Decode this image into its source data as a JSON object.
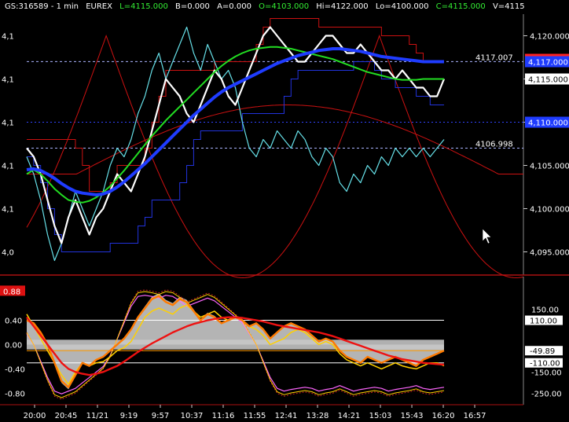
{
  "header": {
    "symbol": "GS:316589 - 1 min",
    "exchange": "EUREX",
    "last": "L=4115.000",
    "bid": "B=0.000",
    "ask": "A=0.000",
    "open": "O=4103.000",
    "high": "Hi=4122.000",
    "low": "Lo=4100.000",
    "close": "C=4115.000",
    "volume": "V=4115"
  },
  "colors": {
    "background": "#000000",
    "price": "#ffffff",
    "cyan_line": "#66e0e8",
    "blue_ma": "#1f3cff",
    "green_ma": "#22dd22",
    "red_bands": "#cc1111",
    "osc_gray": "#c8c8c8",
    "osc_orange": "#ff7a00",
    "osc_yellow": "#ffd000",
    "osc_red": "#ee1111",
    "osc_magenta": "#ff66ff"
  },
  "chart_data": [
    {
      "type": "line",
      "panel": "price",
      "ylim": [
        4092.5,
        4122.5
      ],
      "y_ticks": [
        4095,
        4100,
        4105,
        4110,
        4115,
        4120
      ],
      "y_tick_labels": [
        "4,095.000",
        "4,100.000",
        "4,105.000",
        "4,110.000",
        "4,115.000",
        "4,120.000"
      ],
      "left_tick_labels": [
        "4,0",
        "4,1",
        "4,1",
        "4,1",
        "4,1",
        "4,1"
      ],
      "annotations": [
        {
          "label": "4117.007",
          "value": 4117.007
        },
        {
          "label": "4106.998",
          "value": 4106.998
        }
      ],
      "tags": [
        {
          "label": "4,115.000",
          "value": 4115.0,
          "color": "#ffffff"
        },
        {
          "label": "4,110.000",
          "value": 4110.0,
          "color": "#1f3cff"
        },
        {
          "label": "4,117.000",
          "value": 4117.0,
          "color": "#1f3cff"
        }
      ],
      "x": [
        0,
        1,
        2,
        3,
        4,
        5,
        6,
        7,
        8,
        9,
        10,
        11,
        12,
        13,
        14,
        15,
        16,
        17,
        18,
        19,
        20,
        21,
        22,
        23,
        24,
        25,
        26,
        27,
        28,
        29,
        30,
        31,
        32,
        33,
        34,
        35,
        36,
        37,
        38,
        39,
        40,
        41,
        42,
        43,
        44,
        45,
        46,
        47,
        48,
        49,
        50,
        51,
        52,
        53,
        54,
        55,
        56,
        57,
        58,
        59,
        60
      ],
      "series": [
        {
          "values": [
            4107,
            4106,
            4104,
            4101,
            4098,
            4096,
            4099,
            4101,
            4099,
            4097,
            4099,
            4100,
            4102,
            4104,
            4103,
            4102,
            4104,
            4106,
            4109,
            4112,
            4115,
            4114,
            4113,
            4111,
            4110,
            4112,
            4114,
            4116,
            4115,
            4113,
            4112,
            4114,
            4116,
            4118,
            4120,
            4121,
            4120,
            4119,
            4118,
            4117,
            4117,
            4118,
            4119,
            4120,
            4120,
            4119,
            4118,
            4118,
            4119,
            4118,
            4117,
            4116,
            4116,
            4115,
            4116,
            4115,
            4114,
            4114,
            4113,
            4113,
            4115
          ]
        },
        {
          "values": [
            4106,
            4104,
            4101,
            4097,
            4094,
            4096,
            4099,
            4102,
            4100,
            4098,
            4100,
            4102,
            4105,
            4107,
            4106,
            4108,
            4111,
            4113,
            4116,
            4118,
            4115,
            4117,
            4119,
            4121,
            4118,
            4116,
            4119,
            4117,
            4115,
            4116,
            4114,
            4110,
            4107,
            4106,
            4108,
            4107,
            4109,
            4108,
            4107,
            4109,
            4108,
            4106,
            4105,
            4107,
            4106,
            4103,
            4102,
            4104,
            4103,
            4105,
            4104,
            4106,
            4105,
            4107,
            4106,
            4107,
            4106,
            4107,
            4106,
            4107,
            4108
          ]
        },
        {
          "values": [
            4104.5,
            4104.6,
            4104.4,
            4104.0,
            4103.5,
            4102.9,
            4102.4,
            4102.0,
            4101.8,
            4101.7,
            4101.6,
            4101.7,
            4102.0,
            4102.5,
            4103.1,
            4103.8,
            4104.5,
            4105.2,
            4106.0,
            4106.8,
            4107.6,
            4108.4,
            4109.2,
            4110.0,
            4110.8,
            4111.5,
            4112.2,
            4112.9,
            4113.5,
            4114.0,
            4114.4,
            4114.8,
            4115.2,
            4115.6,
            4116.0,
            4116.4,
            4116.8,
            4117.1,
            4117.4,
            4117.7,
            4117.9,
            4118.1,
            4118.3,
            4118.4,
            4118.5,
            4118.5,
            4118.4,
            4118.3,
            4118.2,
            4118.0,
            4117.8,
            4117.6,
            4117.5,
            4117.4,
            4117.3,
            4117.2,
            4117.1,
            4117.0,
            4117.0,
            4117.0,
            4117.0
          ]
        },
        {
          "values": [
            4104.0,
            4104.5,
            4104.0,
            4103.2,
            4102.3,
            4101.6,
            4101.0,
            4100.8,
            4100.7,
            4100.9,
            4101.3,
            4101.9,
            4102.6,
            4103.5,
            4104.4,
            4105.4,
            4106.4,
            4107.4,
            4108.4,
            4109.3,
            4110.2,
            4111.0,
            4111.8,
            4112.6,
            4113.4,
            4114.2,
            4115.0,
            4115.8,
            4116.5,
            4117.1,
            4117.6,
            4118.0,
            4118.3,
            4118.5,
            4118.6,
            4118.7,
            4118.7,
            4118.6,
            4118.5,
            4118.3,
            4118.1,
            4117.9,
            4117.7,
            4117.5,
            4117.3,
            4117.0,
            4116.7,
            4116.4,
            4116.1,
            4115.8,
            4115.6,
            4115.4,
            4115.2,
            4115.0,
            4114.9,
            4114.9,
            4114.9,
            4115.0,
            4115.0,
            4115.0,
            4115.0
          ]
        }
      ]
    },
    {
      "type": "line",
      "panel": "oscillator",
      "ylim": [
        -0.95,
        0.95
      ],
      "y_ticks": [
        0.4,
        0.0,
        -0.4,
        -0.8
      ],
      "y_tick_labels": [
        "0.40",
        "0.00",
        "-0.40",
        "-0.80"
      ],
      "left_highlight_label": "0.88",
      "right_tick_labels": [
        "150.00",
        "-150.00",
        "-250.00"
      ],
      "right_tags": [
        {
          "label": "110.00",
          "color": "#ffffff"
        },
        {
          "label": "-49.89",
          "color": "#ffffff"
        },
        {
          "label": "-110.00",
          "color": "#ffffff"
        }
      ],
      "x": [
        0,
        1,
        2,
        3,
        4,
        5,
        6,
        7,
        8,
        9,
        10,
        11,
        12,
        13,
        14,
        15,
        16,
        17,
        18,
        19,
        20,
        21,
        22,
        23,
        24,
        25,
        26,
        27,
        28,
        29,
        30,
        31,
        32,
        33,
        34,
        35,
        36,
        37,
        38,
        39,
        40,
        41,
        42,
        43,
        44,
        45,
        46,
        47,
        48,
        49,
        50,
        51,
        52,
        53,
        54,
        55,
        56,
        57,
        58,
        59,
        60
      ],
      "series": [
        {
          "values": [
            0.4,
            0.35,
            0.2,
            0.0,
            -0.3,
            -0.6,
            -0.7,
            -0.5,
            -0.3,
            -0.35,
            -0.25,
            -0.2,
            -0.1,
            0.0,
            0.1,
            0.25,
            0.45,
            0.6,
            0.75,
            0.8,
            0.7,
            0.65,
            0.75,
            0.7,
            0.55,
            0.4,
            0.5,
            0.45,
            0.35,
            0.4,
            0.45,
            0.4,
            0.3,
            0.35,
            0.25,
            0.1,
            0.2,
            0.3,
            0.35,
            0.3,
            0.25,
            0.15,
            0.05,
            0.1,
            0.05,
            -0.1,
            -0.2,
            -0.25,
            -0.3,
            -0.2,
            -0.25,
            -0.3,
            -0.25,
            -0.2,
            -0.25,
            -0.3,
            -0.35,
            -0.25,
            -0.2,
            -0.15,
            -0.1
          ]
        },
        {
          "values": [
            0.5,
            0.3,
            0.1,
            -0.1,
            -0.3,
            -0.5,
            -0.65,
            -0.45,
            -0.3,
            -0.35,
            -0.3,
            -0.28,
            -0.2,
            -0.1,
            -0.05,
            0.05,
            0.25,
            0.45,
            0.55,
            0.6,
            0.55,
            0.5,
            0.6,
            0.65,
            0.55,
            0.45,
            0.5,
            0.55,
            0.45,
            0.4,
            0.45,
            0.4,
            0.3,
            0.25,
            0.15,
            0.0,
            0.05,
            0.1,
            0.2,
            0.25,
            0.2,
            0.1,
            0.0,
            0.05,
            0.0,
            -0.15,
            -0.25,
            -0.3,
            -0.35,
            -0.3,
            -0.35,
            -0.4,
            -0.35,
            -0.3,
            -0.35,
            -0.38,
            -0.4,
            -0.35,
            -0.3,
            -0.3,
            -0.35
          ]
        },
        {
          "values": [
            0.45,
            0.3,
            0.15,
            0.0,
            -0.15,
            -0.3,
            -0.4,
            -0.45,
            -0.48,
            -0.5,
            -0.48,
            -0.45,
            -0.4,
            -0.35,
            -0.28,
            -0.2,
            -0.12,
            -0.05,
            0.02,
            0.08,
            0.14,
            0.2,
            0.25,
            0.3,
            0.34,
            0.37,
            0.4,
            0.42,
            0.44,
            0.45,
            0.45,
            0.44,
            0.42,
            0.4,
            0.38,
            0.35,
            0.32,
            0.3,
            0.28,
            0.26,
            0.24,
            0.22,
            0.2,
            0.17,
            0.14,
            0.1,
            0.06,
            0.02,
            -0.02,
            -0.06,
            -0.1,
            -0.14,
            -0.18,
            -0.21,
            -0.24,
            -0.26,
            -0.28,
            -0.3,
            -0.31,
            -0.32,
            -0.33
          ]
        },
        {
          "values": [
            0.2,
            0.0,
            -0.3,
            -0.6,
            -0.85,
            -0.9,
            -0.85,
            -0.8,
            -0.7,
            -0.6,
            -0.5,
            -0.4,
            -0.2,
            0.1,
            0.4,
            0.7,
            0.88,
            0.9,
            0.88,
            0.85,
            0.9,
            0.88,
            0.8,
            0.7,
            0.75,
            0.8,
            0.85,
            0.8,
            0.7,
            0.6,
            0.5,
            0.4,
            0.2,
            0.0,
            -0.3,
            -0.6,
            -0.8,
            -0.85,
            -0.82,
            -0.8,
            -0.78,
            -0.8,
            -0.85,
            -0.82,
            -0.8,
            -0.75,
            -0.8,
            -0.85,
            -0.82,
            -0.8,
            -0.78,
            -0.8,
            -0.85,
            -0.82,
            -0.8,
            -0.78,
            -0.75,
            -0.8,
            -0.82,
            -0.8,
            -0.78
          ]
        }
      ]
    }
  ],
  "x_axis": {
    "labels": [
      "20:00",
      "20:45",
      "11/21",
      "9:19",
      "9:57",
      "10:37",
      "11:16",
      "11:55",
      "12:41",
      "13:28",
      "14:21",
      "15:03",
      "15:43",
      "16:20",
      "16:57"
    ],
    "label_bar_index": [
      1,
      5,
      9,
      13,
      17,
      21,
      25,
      29,
      33,
      37,
      41,
      45,
      49,
      53,
      57
    ]
  }
}
